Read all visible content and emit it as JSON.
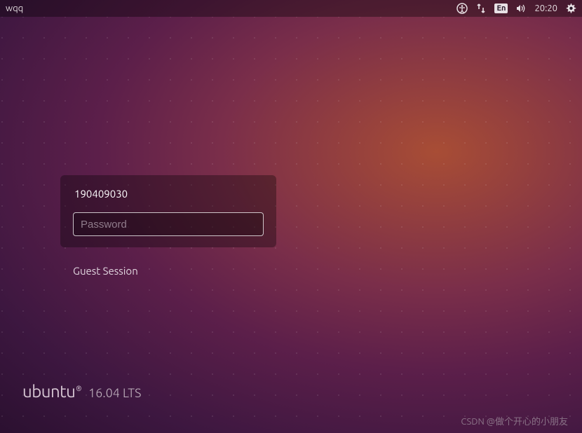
{
  "panel": {
    "hostname": "wqq",
    "language": "En",
    "clock": "20:20"
  },
  "login": {
    "username": "190409030",
    "password_placeholder": "Password",
    "guest_label": "Guest Session"
  },
  "branding": {
    "name": "ubuntu",
    "symbol": "®",
    "version": "16.04 LTS"
  },
  "watermark": "CSDN @做个开心的小朋友"
}
